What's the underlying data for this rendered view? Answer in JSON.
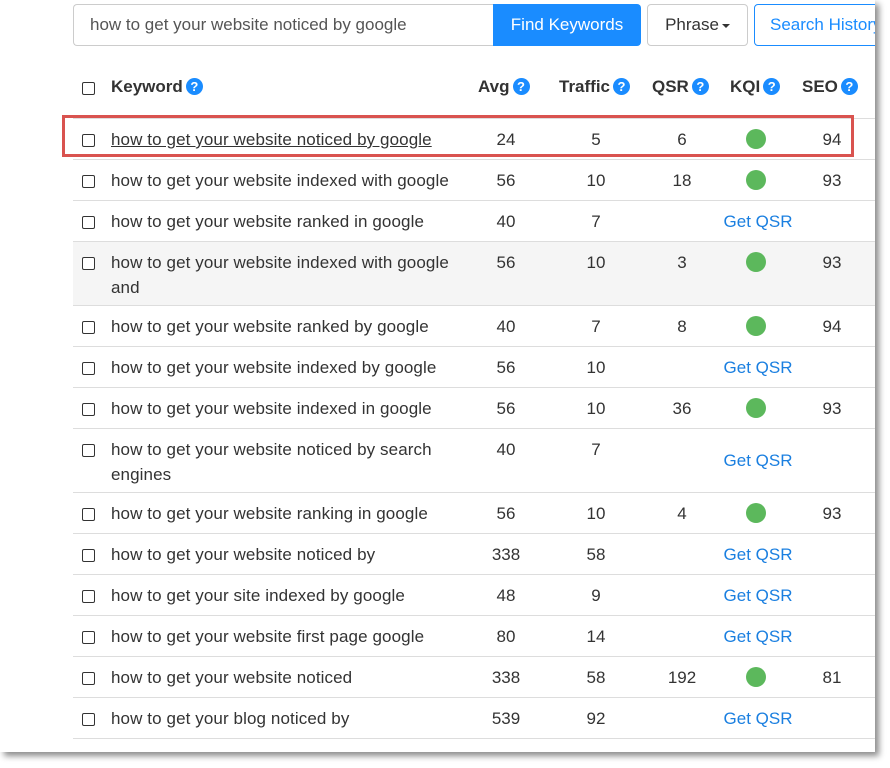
{
  "search": {
    "value": "how to get your website noticed by google",
    "find_label": "Find Keywords",
    "phrase_label": "Phrase",
    "history_label": "Search History"
  },
  "table": {
    "headers": {
      "keyword": "Keyword",
      "avg": "Avg",
      "traffic": "Traffic",
      "qsr": "QSR",
      "kqi": "KQI",
      "seo": "SEO",
      "help_glyph": "?"
    },
    "get_qsr_label": "Get QSR",
    "kqi_color": "#5cb85c",
    "highlight_color": "#d9534f",
    "rows": [
      {
        "keyword": "how to get your website noticed by google",
        "avg": "24",
        "traffic": "5",
        "qsr": "6",
        "kqi": "green",
        "seo": "94",
        "highlighted": true
      },
      {
        "keyword": "how to get your website indexed with google",
        "avg": "56",
        "traffic": "10",
        "qsr": "18",
        "kqi": "green",
        "seo": "93"
      },
      {
        "keyword": "how to get your website ranked in google",
        "avg": "40",
        "traffic": "7",
        "qsr": null,
        "kqi": null,
        "seo": null
      },
      {
        "keyword": "how to get your website indexed with google and",
        "avg": "56",
        "traffic": "10",
        "qsr": "3",
        "kqi": "green",
        "seo": "93",
        "shaded": true
      },
      {
        "keyword": "how to get your website ranked by google",
        "avg": "40",
        "traffic": "7",
        "qsr": "8",
        "kqi": "green",
        "seo": "94"
      },
      {
        "keyword": "how to get your website indexed by google",
        "avg": "56",
        "traffic": "10",
        "qsr": null,
        "kqi": null,
        "seo": null
      },
      {
        "keyword": "how to get your website indexed in google",
        "avg": "56",
        "traffic": "10",
        "qsr": "36",
        "kqi": "green",
        "seo": "93"
      },
      {
        "keyword": "how to get your website noticed by search engines",
        "avg": "40",
        "traffic": "7",
        "qsr": null,
        "kqi": null,
        "seo": null
      },
      {
        "keyword": "how to get your website ranking in google",
        "avg": "56",
        "traffic": "10",
        "qsr": "4",
        "kqi": "green",
        "seo": "93"
      },
      {
        "keyword": "how to get your website noticed by",
        "avg": "338",
        "traffic": "58",
        "qsr": null,
        "kqi": null,
        "seo": null
      },
      {
        "keyword": "how to get your site indexed by google",
        "avg": "48",
        "traffic": "9",
        "qsr": null,
        "kqi": null,
        "seo": null
      },
      {
        "keyword": "how to get your website first page google",
        "avg": "80",
        "traffic": "14",
        "qsr": null,
        "kqi": null,
        "seo": null
      },
      {
        "keyword": "how to get your website noticed",
        "avg": "338",
        "traffic": "58",
        "qsr": "192",
        "kqi": "green",
        "seo": "81"
      },
      {
        "keyword": "how to get your blog noticed by",
        "avg": "539",
        "traffic": "92",
        "qsr": null,
        "kqi": null,
        "seo": null
      }
    ]
  }
}
